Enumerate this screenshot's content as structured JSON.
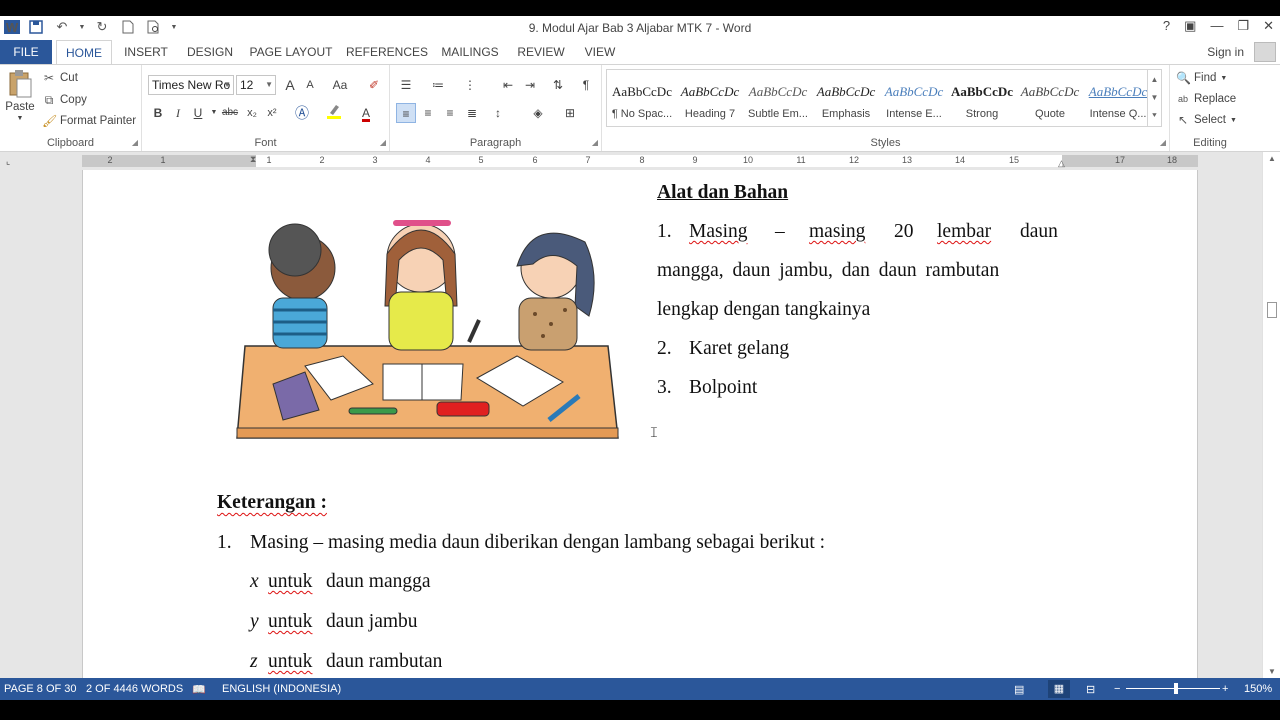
{
  "window": {
    "title": "9. Modul Ajar Bab 3 Aljabar MTK 7 - Word",
    "help": "?",
    "sign_in": "Sign in"
  },
  "qat": {
    "logo": "W"
  },
  "tabs": [
    {
      "label": "FILE"
    },
    {
      "label": "HOME"
    },
    {
      "label": "INSERT"
    },
    {
      "label": "DESIGN"
    },
    {
      "label": "PAGE LAYOUT"
    },
    {
      "label": "REFERENCES"
    },
    {
      "label": "MAILINGS"
    },
    {
      "label": "REVIEW"
    },
    {
      "label": "VIEW"
    }
  ],
  "clipboard": {
    "paste": "Paste",
    "cut": "Cut",
    "copy": "Copy",
    "format_painter": "Format Painter",
    "label": "Clipboard"
  },
  "font": {
    "name": "Times New Ro",
    "size": "12",
    "label": "Font",
    "bold": "B",
    "italic": "I",
    "underline": "U",
    "strike": "abc",
    "sub": "x₂",
    "sup": "x²",
    "grow": "A",
    "shrink": "A",
    "case": "Aa",
    "font_color": "A"
  },
  "paragraph": {
    "label": "Paragraph",
    "pilcrow": "¶"
  },
  "styles": {
    "label": "Styles",
    "items": [
      {
        "preview": "AaBbCcDc",
        "name": "¶ No Spac..."
      },
      {
        "preview": "AaBbCcDc",
        "name": "Heading 7"
      },
      {
        "preview": "AaBbCcDc",
        "name": "Subtle Em..."
      },
      {
        "preview": "AaBbCcDc",
        "name": "Emphasis"
      },
      {
        "preview": "AaBbCcDc",
        "name": "Intense E..."
      },
      {
        "preview": "AaBbCcDc",
        "name": "Strong"
      },
      {
        "preview": "AaBbCcDc",
        "name": "Quote"
      },
      {
        "preview": "AaBbCcDc",
        "name": "Intense Q..."
      }
    ]
  },
  "editing": {
    "label": "Editing",
    "find": "Find",
    "replace": "Replace",
    "select": "Select"
  },
  "ruler": {
    "numbers": [
      "2",
      "1",
      "1",
      "1",
      "2",
      "3",
      "4",
      "5",
      "6",
      "7",
      "8",
      "9",
      "10",
      "11",
      "12",
      "13",
      "14",
      "15",
      "16",
      "17",
      "18"
    ]
  },
  "document": {
    "heading_tools": "Alat dan Bahan",
    "tools_1_num": "1.",
    "tools_1_w1": "Masing",
    "tools_1_w2": "–",
    "tools_1_w3": "masing",
    "tools_1_w4": "20",
    "tools_1_w5": "lembar",
    "tools_1_w6": "daun",
    "tools_1_line2": "mangga, daun jambu, dan daun rambutan",
    "tools_1_line3": "lengkap dengan tangkainya",
    "tools_2_num": "2.",
    "tools_2": "Karet gelang",
    "tools_3_num": "3.",
    "tools_3": "Bolpoint",
    "heading_notes": "Keterangan :",
    "note_1_num": "1.",
    "note_1": "Masing – masing media daun diberikan dengan lambang sebagai berikut :",
    "var_x": "x",
    "var_y": "y",
    "var_z": "z",
    "untuk": "untuk",
    "leaf_x": "daun mangga",
    "leaf_y": "daun jambu",
    "leaf_z": "daun rambutan"
  },
  "status": {
    "page": "PAGE 8 OF 30",
    "words": "2 OF 4446 WORDS",
    "language": "ENGLISH (INDONESIA)",
    "zoom": "150%",
    "zoom_minus": "−",
    "zoom_plus": "+"
  },
  "colors": {
    "word_blue": "#2b579a",
    "spell_red": "#d11"
  }
}
